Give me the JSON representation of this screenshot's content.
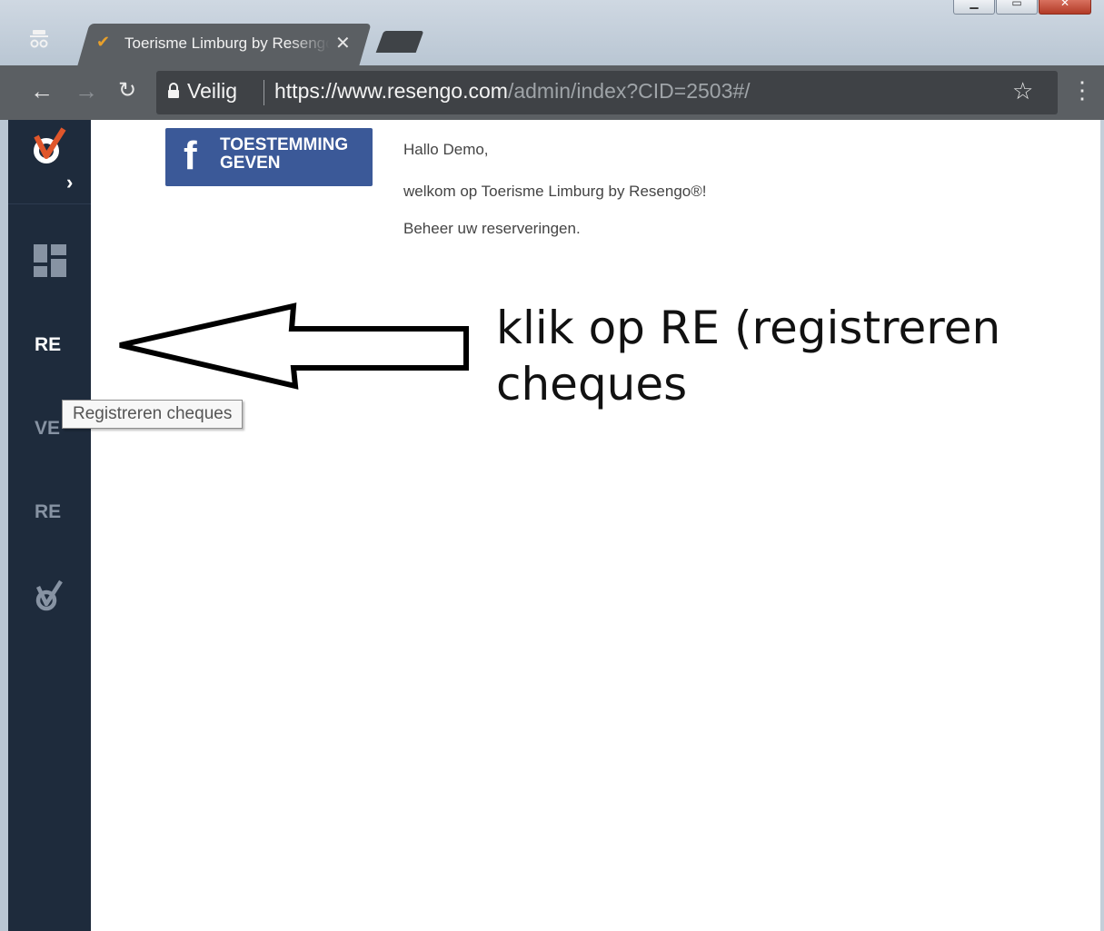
{
  "browser": {
    "tab_title": "Toerisme Limburg by Resengo",
    "tab_close": "✕",
    "secure_label": "Veilig",
    "url_host": "https://www.resengo.com",
    "url_path": "/admin/index?CID=2503#/",
    "icons": {
      "back": "back-arrow-icon",
      "forward": "forward-arrow-icon",
      "reload": "reload-icon",
      "lock": "lock-icon",
      "star": "bookmark-star-icon",
      "menu": "menu-dots-icon",
      "incognito": "incognito-icon"
    }
  },
  "sidebar": {
    "items": [
      {
        "label": "RE",
        "state": "active"
      },
      {
        "label": "VE",
        "state": "dim"
      },
      {
        "label": "RE",
        "state": "dim"
      }
    ],
    "tooltip": "Registreren cheques"
  },
  "main": {
    "facebook_button": "TOESTEMMING GEVEN",
    "greeting": "Hallo Demo,",
    "welcome": "welkom op Toerisme Limburg by Resengo®!",
    "subtitle": "Beheer uw reserveringen."
  },
  "annotation": {
    "line1": "klik op RE (registreren",
    "line2": "cheques"
  },
  "colors": {
    "sidebar": "#1e2b3c",
    "facebook": "#3b5998",
    "chrome": "#5b5f63"
  }
}
